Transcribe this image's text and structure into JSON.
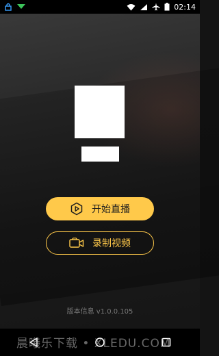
{
  "status_bar": {
    "time": "02:14",
    "icons": [
      "lock-icon",
      "notification-arrow-icon",
      "wifi-icon",
      "signal-icon",
      "airplane-icon",
      "battery-icon"
    ]
  },
  "main": {
    "live_button_label": "开始直播",
    "record_button_label": "录制视频",
    "version_text": "版本信息 v1.0.0.105"
  },
  "watermark": "晨曦乐下载 • XLEDU.COM",
  "colors": {
    "accent": "#FFC94A",
    "background": "#1c1c1c",
    "bar": "#000000"
  },
  "nav": {
    "icons": [
      "back-icon",
      "home-icon",
      "recents-icon"
    ]
  }
}
